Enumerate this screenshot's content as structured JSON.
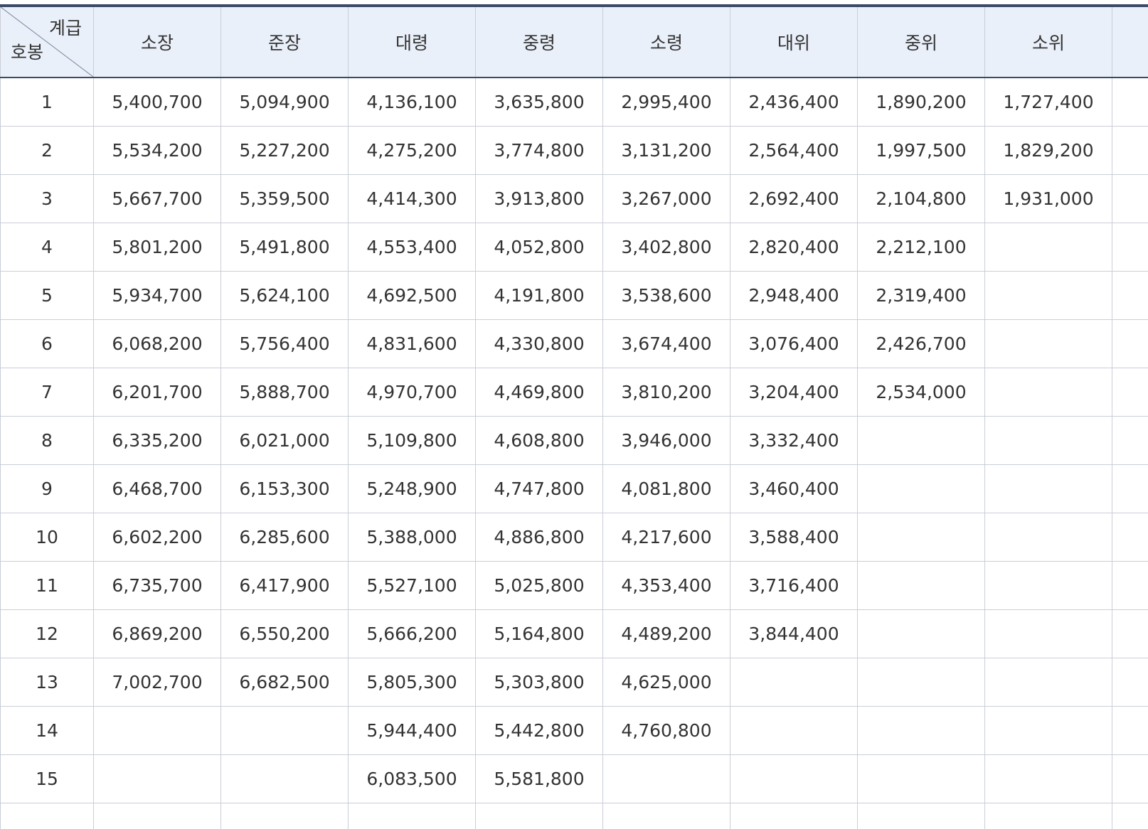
{
  "table": {
    "corner": {
      "top_label": "계급",
      "bottom_label": "호봉"
    },
    "columns": [
      "소장",
      "준장",
      "대령",
      "중령",
      "소령",
      "대위",
      "중위",
      "소위"
    ],
    "rows": [
      {
        "step": "1",
        "values": [
          "5,400,700",
          "5,094,900",
          "4,136,100",
          "3,635,800",
          "2,995,400",
          "2,436,400",
          "1,890,200",
          "1,727,400"
        ]
      },
      {
        "step": "2",
        "values": [
          "5,534,200",
          "5,227,200",
          "4,275,200",
          "3,774,800",
          "3,131,200",
          "2,564,400",
          "1,997,500",
          "1,829,200"
        ]
      },
      {
        "step": "3",
        "values": [
          "5,667,700",
          "5,359,500",
          "4,414,300",
          "3,913,800",
          "3,267,000",
          "2,692,400",
          "2,104,800",
          "1,931,000"
        ]
      },
      {
        "step": "4",
        "values": [
          "5,801,200",
          "5,491,800",
          "4,553,400",
          "4,052,800",
          "3,402,800",
          "2,820,400",
          "2,212,100",
          ""
        ]
      },
      {
        "step": "5",
        "values": [
          "5,934,700",
          "5,624,100",
          "4,692,500",
          "4,191,800",
          "3,538,600",
          "2,948,400",
          "2,319,400",
          ""
        ]
      },
      {
        "step": "6",
        "values": [
          "6,068,200",
          "5,756,400",
          "4,831,600",
          "4,330,800",
          "3,674,400",
          "3,076,400",
          "2,426,700",
          ""
        ]
      },
      {
        "step": "7",
        "values": [
          "6,201,700",
          "5,888,700",
          "4,970,700",
          "4,469,800",
          "3,810,200",
          "3,204,400",
          "2,534,000",
          ""
        ]
      },
      {
        "step": "8",
        "values": [
          "6,335,200",
          "6,021,000",
          "5,109,800",
          "4,608,800",
          "3,946,000",
          "3,332,400",
          "",
          ""
        ]
      },
      {
        "step": "9",
        "values": [
          "6,468,700",
          "6,153,300",
          "5,248,900",
          "4,747,800",
          "4,081,800",
          "3,460,400",
          "",
          ""
        ]
      },
      {
        "step": "10",
        "values": [
          "6,602,200",
          "6,285,600",
          "5,388,000",
          "4,886,800",
          "4,217,600",
          "3,588,400",
          "",
          ""
        ]
      },
      {
        "step": "11",
        "values": [
          "6,735,700",
          "6,417,900",
          "5,527,100",
          "5,025,800",
          "4,353,400",
          "3,716,400",
          "",
          ""
        ]
      },
      {
        "step": "12",
        "values": [
          "6,869,200",
          "6,550,200",
          "5,666,200",
          "5,164,800",
          "4,489,200",
          "3,844,400",
          "",
          ""
        ]
      },
      {
        "step": "13",
        "values": [
          "7,002,700",
          "6,682,500",
          "5,805,300",
          "5,303,800",
          "4,625,000",
          "",
          "",
          ""
        ]
      },
      {
        "step": "14",
        "values": [
          "",
          "",
          "5,944,400",
          "5,442,800",
          "4,760,800",
          "",
          "",
          ""
        ]
      },
      {
        "step": "15",
        "values": [
          "",
          "",
          "6,083,500",
          "5,581,800",
          "",
          "",
          "",
          ""
        ]
      },
      {
        "step": "",
        "values": [
          "",
          "",
          "",
          "",
          "",
          "",
          "",
          ""
        ]
      }
    ]
  }
}
